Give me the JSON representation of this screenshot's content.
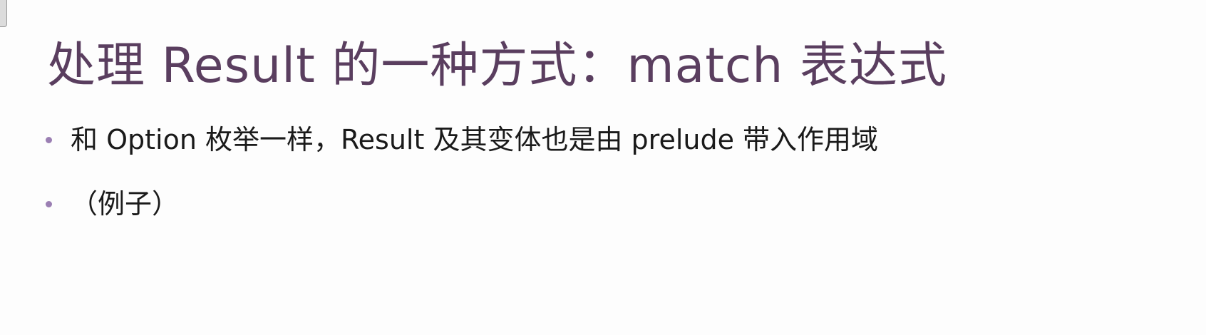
{
  "slide": {
    "title": "处理 Result 的一种方式：match 表达式",
    "bullets": [
      {
        "text": "和 Option 枚举一样，Result 及其变体也是由 prelude 带入作用域"
      },
      {
        "text": "（例子）"
      }
    ]
  },
  "colors": {
    "title": "#5a3e5f",
    "bullet_dot": "#9b7fb3",
    "body_text": "#1a1a1a",
    "background": "#fdfdfd"
  }
}
